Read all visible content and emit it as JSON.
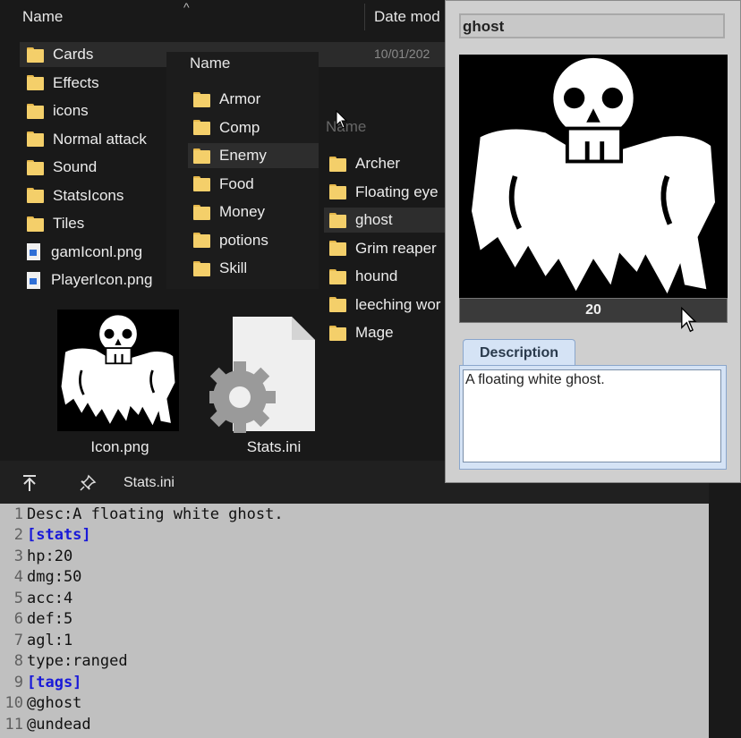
{
  "explorer": {
    "col_name": "Name",
    "col_date": "Date mod",
    "col_date_partial": "10/01/202",
    "main_items": [
      {
        "label": "Cards",
        "type": "folder"
      },
      {
        "label": "Effects",
        "type": "folder"
      },
      {
        "label": "icons",
        "type": "folder"
      },
      {
        "label": "Normal attack",
        "type": "folder"
      },
      {
        "label": "Sound",
        "type": "folder"
      },
      {
        "label": "StatsIcons",
        "type": "folder"
      },
      {
        "label": "Tiles",
        "type": "folder"
      },
      {
        "label": "gamIconl.png",
        "type": "file"
      },
      {
        "label": "PlayerIcon.png",
        "type": "file"
      }
    ],
    "sub_header": "Name",
    "sub_items": [
      "Armor",
      "Comp",
      "Enemy",
      "Food",
      "Money",
      "potions",
      "Skill"
    ],
    "sub_selected": "Enemy",
    "sub2_header": "Name",
    "sub2_items": [
      "Archer",
      "Floating eye",
      "ghost",
      "Grim reaper",
      "hound",
      "leeching wor",
      "Mage"
    ],
    "sub2_selected": "ghost",
    "thumbs": [
      {
        "label": "Icon.png",
        "icon": "ghost-skull-icon"
      },
      {
        "label": "Stats.ini",
        "icon": "settings-file-icon"
      }
    ]
  },
  "toolbar": {
    "pin_icon": "pin-icon",
    "top_icon": "scroll-top-icon",
    "filename": "Stats.ini"
  },
  "editor": {
    "lines": [
      {
        "n": "1",
        "text": "Desc:A floating white ghost.",
        "kind": "plain"
      },
      {
        "n": "2",
        "text": "[stats]",
        "kind": "section"
      },
      {
        "n": "3",
        "text": "hp:20",
        "kind": "plain"
      },
      {
        "n": "4",
        "text": "dmg:50",
        "kind": "plain"
      },
      {
        "n": "5",
        "text": "acc:4",
        "kind": "plain"
      },
      {
        "n": "6",
        "text": "def:5",
        "kind": "plain"
      },
      {
        "n": "7",
        "text": "agl:1",
        "kind": "plain"
      },
      {
        "n": "8",
        "text": "type:ranged",
        "kind": "plain"
      },
      {
        "n": "9",
        "text": "[tags]",
        "kind": "section"
      },
      {
        "n": "10",
        "text": "@ghost",
        "kind": "plain"
      },
      {
        "n": "11",
        "text": "@undead",
        "kind": "plain"
      }
    ]
  },
  "card": {
    "name_value": "ghost",
    "hp_value": "20",
    "tab_label": "Description",
    "description": "A floating white ghost.",
    "image_icon": "ghost-skull-icon"
  },
  "colors": {
    "folder": "#f4cf6a",
    "section": "#1a1ad8",
    "tab": "#d5e3f5"
  }
}
